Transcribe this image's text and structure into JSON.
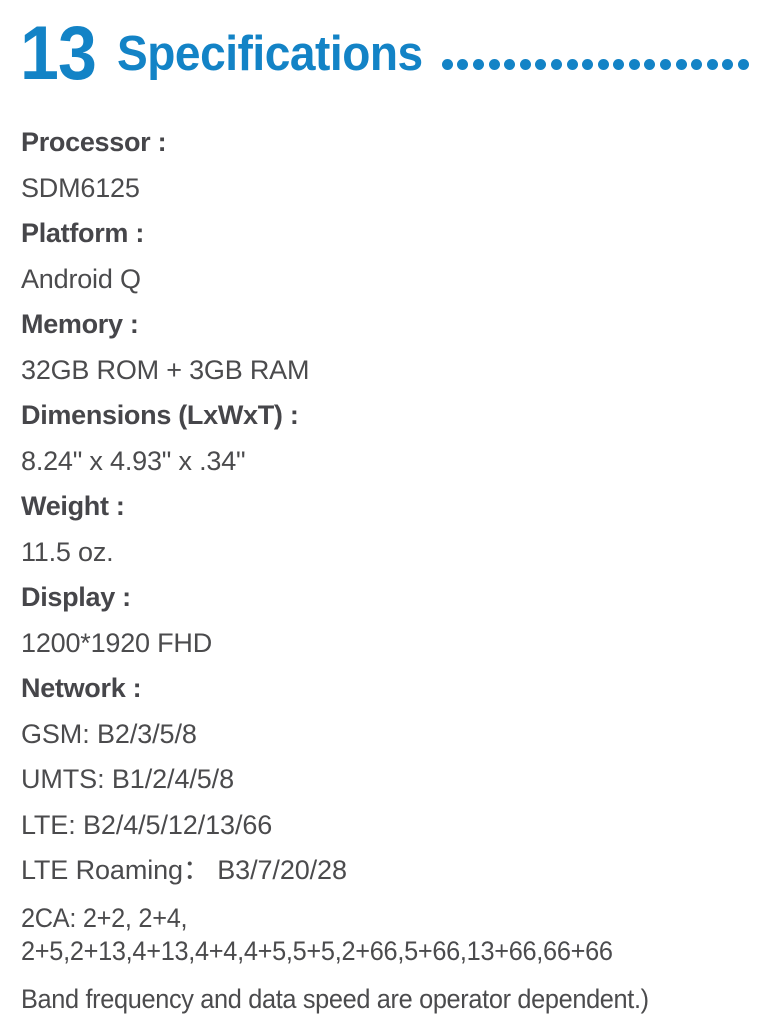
{
  "header": {
    "number": "13",
    "title": "Specifications",
    "dot_count": 23,
    "accent_color": "#1383c6"
  },
  "colors": {
    "accent": "#1383c6",
    "body_text": "#4b4b4d",
    "label_text": "#46464a",
    "background": "#ffffff"
  },
  "spec_lines": [
    {
      "label": "Processor :",
      "value": "SDM6125"
    },
    {
      "label": "Platform :",
      "value": "Android Q"
    },
    {
      "label": "Memory :",
      "value": "32GB ROM + 3GB RAM"
    },
    {
      "label": "Dimensions (LxWxT) :",
      "value": "8.24\" x 4.93\" x .34\""
    },
    {
      "label": "Weight :",
      "value": "11.5 oz."
    },
    {
      "label": "Display :",
      "value": "1200*1920 FHD"
    }
  ],
  "network": {
    "label": "Network :",
    "rows": [
      "GSM: B2/3/5/8",
      "UMTS: B1/2/4/5/8",
      "LTE: B2/4/5/12/13/66",
      "LTE Roaming： B3/7/20/28"
    ],
    "carrier_aggregation": "2CA: 2+2, 2+4, 2+5,2+13,4+13,4+4,4+5,5+5,2+66,5+66,13+66,66+66",
    "note": "Band frequency and data speed are operator dependent.)"
  }
}
